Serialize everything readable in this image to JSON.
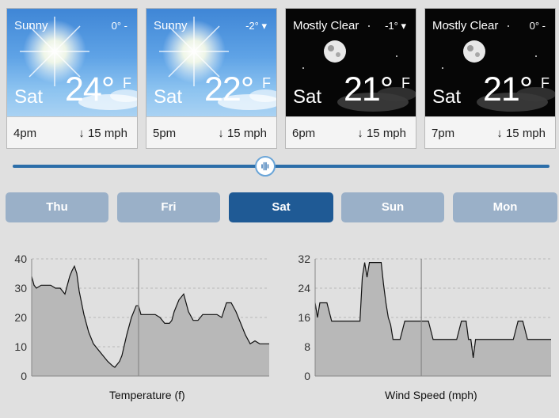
{
  "forecast_cards": [
    {
      "condition": "Sunny",
      "delta": "0° -",
      "day": "Sat",
      "temp": "24°",
      "unit": "F",
      "time": "4pm",
      "wind": "↓ 15 mph",
      "sky": "day"
    },
    {
      "condition": "Sunny",
      "delta": "-2° ▾",
      "day": "Sat",
      "temp": "22°",
      "unit": "F",
      "time": "5pm",
      "wind": "↓ 15 mph",
      "sky": "day"
    },
    {
      "condition": "Mostly Clear",
      "delta": "-1° ▾",
      "day": "Sat",
      "temp": "21°",
      "unit": "F",
      "time": "6pm",
      "wind": "↓ 15 mph",
      "sky": "night"
    },
    {
      "condition": "Mostly Clear",
      "delta": "0° -",
      "day": "Sat",
      "temp": "21°",
      "unit": "F",
      "time": "7pm",
      "wind": "↓ 15 mph",
      "sky": "night"
    }
  ],
  "timeline_slider": {
    "position": 0.47
  },
  "day_tabs": [
    {
      "label": "Thu",
      "active": false
    },
    {
      "label": "Fri",
      "active": false
    },
    {
      "label": "Sat",
      "active": true
    },
    {
      "label": "Sun",
      "active": false
    },
    {
      "label": "Mon",
      "active": false
    }
  ],
  "colors": {
    "accent": "#1f5a95",
    "tab_inactive": "#9ab0c8",
    "chart_fill": "#b8b8b8"
  },
  "chart_data": [
    {
      "type": "area",
      "title": "Temperature (f)",
      "yticks": [
        0,
        10,
        20,
        30,
        40
      ],
      "ylim": [
        0,
        40
      ],
      "xlim": [
        0,
        100
      ],
      "current_marker_x": 45,
      "x": [
        0,
        1,
        2,
        4,
        6,
        8,
        10,
        12,
        14,
        16,
        17,
        18,
        19,
        20,
        22,
        24,
        26,
        28,
        30,
        32,
        34,
        35,
        36,
        37,
        38,
        40,
        42,
        44,
        45,
        46,
        48,
        50,
        52,
        54,
        56,
        58,
        59,
        60,
        62,
        64,
        66,
        68,
        70,
        72,
        74,
        76,
        78,
        80,
        82,
        84,
        86,
        88,
        90,
        92,
        94,
        96,
        98,
        100
      ],
      "values": [
        34,
        31,
        30,
        31,
        31,
        31,
        30,
        30,
        28,
        34,
        36,
        37.5,
        35,
        29,
        21,
        15,
        11,
        9,
        7,
        5,
        3.5,
        3,
        4,
        5,
        7,
        14,
        20,
        24,
        24,
        21,
        21,
        21,
        21,
        20,
        18,
        18,
        19,
        22,
        26,
        28,
        22,
        19,
        19,
        21,
        21,
        21,
        21,
        20,
        25,
        25,
        22,
        18,
        14,
        11,
        12,
        11,
        11,
        11
      ]
    },
    {
      "type": "area",
      "title": "Wind Speed (mph)",
      "yticks": [
        0,
        8,
        16,
        24,
        32
      ],
      "ylim": [
        0,
        32
      ],
      "xlim": [
        0,
        100
      ],
      "current_marker_x": 45,
      "x": [
        0,
        1,
        2,
        3,
        5,
        7,
        9,
        11,
        13,
        15,
        17,
        19,
        20,
        21,
        22,
        23,
        24,
        26,
        28,
        29,
        30,
        31,
        32,
        33,
        34,
        36,
        38,
        40,
        42,
        44,
        46,
        48,
        50,
        52,
        54,
        56,
        58,
        60,
        62,
        64,
        65,
        66,
        67,
        68,
        70,
        72,
        74,
        76,
        78,
        80,
        82,
        84,
        86,
        88,
        90,
        92,
        94,
        96,
        98,
        100
      ],
      "values": [
        20,
        16,
        20,
        20,
        20,
        15,
        15,
        15,
        15,
        15,
        15,
        15,
        27,
        31,
        27,
        31,
        31,
        31,
        31,
        25,
        20,
        16,
        14,
        10,
        10,
        10,
        15,
        15,
        15,
        15,
        15,
        15,
        10,
        10,
        10,
        10,
        10,
        10,
        15,
        15,
        10,
        10,
        5,
        10,
        10,
        10,
        10,
        10,
        10,
        10,
        10,
        10,
        15,
        15,
        10,
        10,
        10,
        10,
        10,
        10
      ]
    }
  ]
}
